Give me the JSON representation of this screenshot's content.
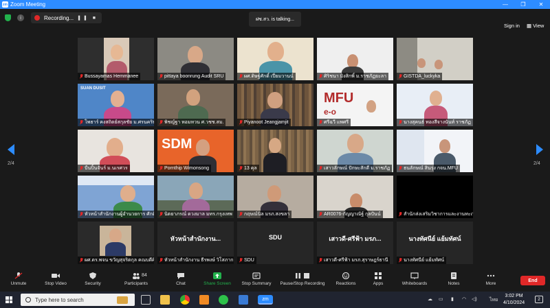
{
  "window": {
    "title": "Zoom Meeting",
    "app_icon": "zm"
  },
  "topbar": {
    "recording_label": "Recording...",
    "recording_controls": "❚❚ ■",
    "talking_label": "ฝซ.สว. is talking...",
    "signin_label": "Sign in",
    "view_label": "View"
  },
  "pagination": {
    "current": "2/4"
  },
  "participants": [
    {
      "name": "Bussayamas Hemmanee"
    },
    {
      "name": "pittaya boonrung Audit SRU"
    },
    {
      "name": "ผศ.ดิษฐ์ศักดิ์ เปี่ยมวานน์"
    },
    {
      "name": "ศิริชนา มิงสิกพิ์ ม.ราชภัฏยะลา"
    },
    {
      "name": "GISTDA_luckyka"
    },
    {
      "name": "โพธาร์ คงสถิตย์สกุลชัย ม.ศรนครินทร์"
    },
    {
      "name": "พิชญ์ฐา หอมหวน ศ.วชช.สม."
    },
    {
      "name": "Piyanoot Jeangjamjit"
    },
    {
      "name": "ศรีฉวี แพศรี"
    },
    {
      "name": "นางสุคนธ์ ทองสีจางนันท์ ราชภัฏ"
    },
    {
      "name": "บืนปิ้นจันร์ ม.นเรศวร"
    },
    {
      "name": "Pornthip Wimonsong"
    },
    {
      "name": "13 คุล"
    },
    {
      "name": "เสาวลักษณ์ ปักษะสักดี ม.ราชภัฏ"
    },
    {
      "name": "ธนลักษณ์ สินรุ่ง กจน.MFU"
    },
    {
      "name": "หัวหน้าสำนักงานผู้อำนวยการ ศักดิ์ศิริ"
    },
    {
      "name": "นิตยาภรณ์ ดวงมาล มทร.กรุงเทพ"
    },
    {
      "name": "กฤษณ์นิล มรภ.สงขลา"
    },
    {
      "name": "AR0076-กัญญาณัฐ์ กุลปันน์"
    },
    {
      "name": "สำนักส่งเสริมวิชาการและงานทะเบียน"
    },
    {
      "name": "ผศ.ดร.พจน ขวัญสุจริตกุล คณบดีศิลปกรรม"
    },
    {
      "name": "หัวหน้าสำนักงาน ธีรพงษ์ วิโสภาก",
      "display": "หัวหน้าสำนักงาน..."
    },
    {
      "name": "SDU",
      "display": "SDU"
    },
    {
      "name": "เสาวดี-ศรีฟ้า มรภ.สุราษฎร์ธานี",
      "display": "เสาวดี-ศรีฟ้า มรภ..."
    },
    {
      "name": "นางทัศนีย์ แย้มทัศน์",
      "display": "นางทัศนีย์ แย้มทัศน์"
    }
  ],
  "tile_texts": {
    "suan_dusit": "SUAN DUSIT",
    "sdm": "SDM",
    "mfu": "MFU",
    "mfu_sub": "e-o"
  },
  "toolbar": {
    "unmute": "Unmute",
    "stop_video": "Stop Video",
    "security": "Security",
    "participants": "Participants",
    "participants_count": "84",
    "chat": "Chat",
    "share_screen": "Share Screen",
    "stop_summary": "Stop Summary",
    "pause_recording": "Pause/Stop Recording",
    "reactions": "Reactions",
    "apps": "Apps",
    "whiteboards": "Whiteboards",
    "notes": "Notes",
    "more": "More",
    "end": "End"
  },
  "taskbar": {
    "search_placeholder": "Type here to search",
    "time": "3:02 PM",
    "date": "4/10/2024",
    "lang": "ไทย",
    "notif_count": "2"
  },
  "colors": {
    "accent": "#2d8cff",
    "end": "#e02828",
    "share": "#22b14c"
  }
}
